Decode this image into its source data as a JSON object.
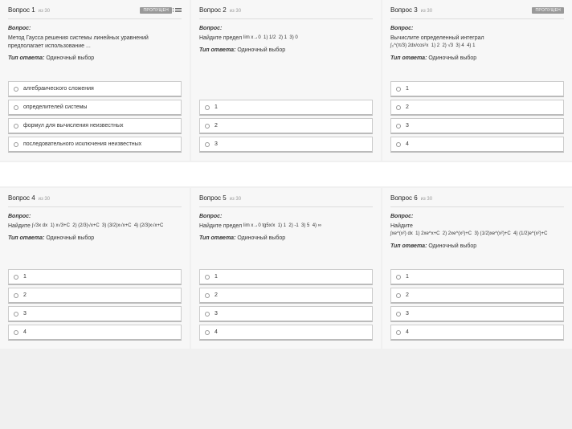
{
  "labels": {
    "question_label": "Вопрос:",
    "type_label": "Тип ответа:",
    "type_value": "Одиночный выбор",
    "of_label": "из",
    "badge": "ПРОПУЩЕН",
    "total": "30"
  },
  "questions": [
    {
      "num": "Вопрос 1",
      "text": "Метод Гаусса решения системы линейных уравнений предполагает использование ...",
      "options": [
        "алгебраического сложения",
        "определителей системы",
        "формул для вычисления неизвестных",
        "последовательного исключения неизвестных"
      ],
      "badge": true,
      "showListIcon": true
    },
    {
      "num": "Вопрос 2",
      "prefix": "Найдите предел",
      "math": "lim x→0  1) 1/2  2) 1  3) 0",
      "options": [
        "1",
        "2",
        "3"
      ],
      "badge": false
    },
    {
      "num": "Вопрос 3",
      "prefix": "Вычислите определенный интеграл",
      "math": "∫₀^(π/3) 2dx/cos²x  1) 2  2) √3  3) 4  4) 1",
      "options": [
        "1",
        "2",
        "3",
        "4"
      ],
      "badge": true
    },
    {
      "num": "Вопрос 4",
      "prefix": "Найдите",
      "math": "∫√3x dx  1) x√3+C  2) (2/3)√x+C  3) (3/2)x√x+C  4) (2/3)x√x+C",
      "options": [
        "1",
        "2",
        "3",
        "4"
      ],
      "badge": false
    },
    {
      "num": "Вопрос 5",
      "prefix": "Найдите предел",
      "math": "lim x→0 tg5x/x  1) 1  2) -1  3) 5  4) ∞",
      "options": [
        "1",
        "2",
        "3",
        "4"
      ],
      "badge": false
    },
    {
      "num": "Вопрос 6",
      "prefix": "Найдите",
      "math": "∫xe^(x²) dx  1) 2xe^x+C  2) 2xe^(x²)+C  3) (1/2)xe^(x²)+C  4) (1/2)e^(x²)+C",
      "options": [
        "1",
        "2",
        "3",
        "4"
      ],
      "badge": false
    }
  ]
}
